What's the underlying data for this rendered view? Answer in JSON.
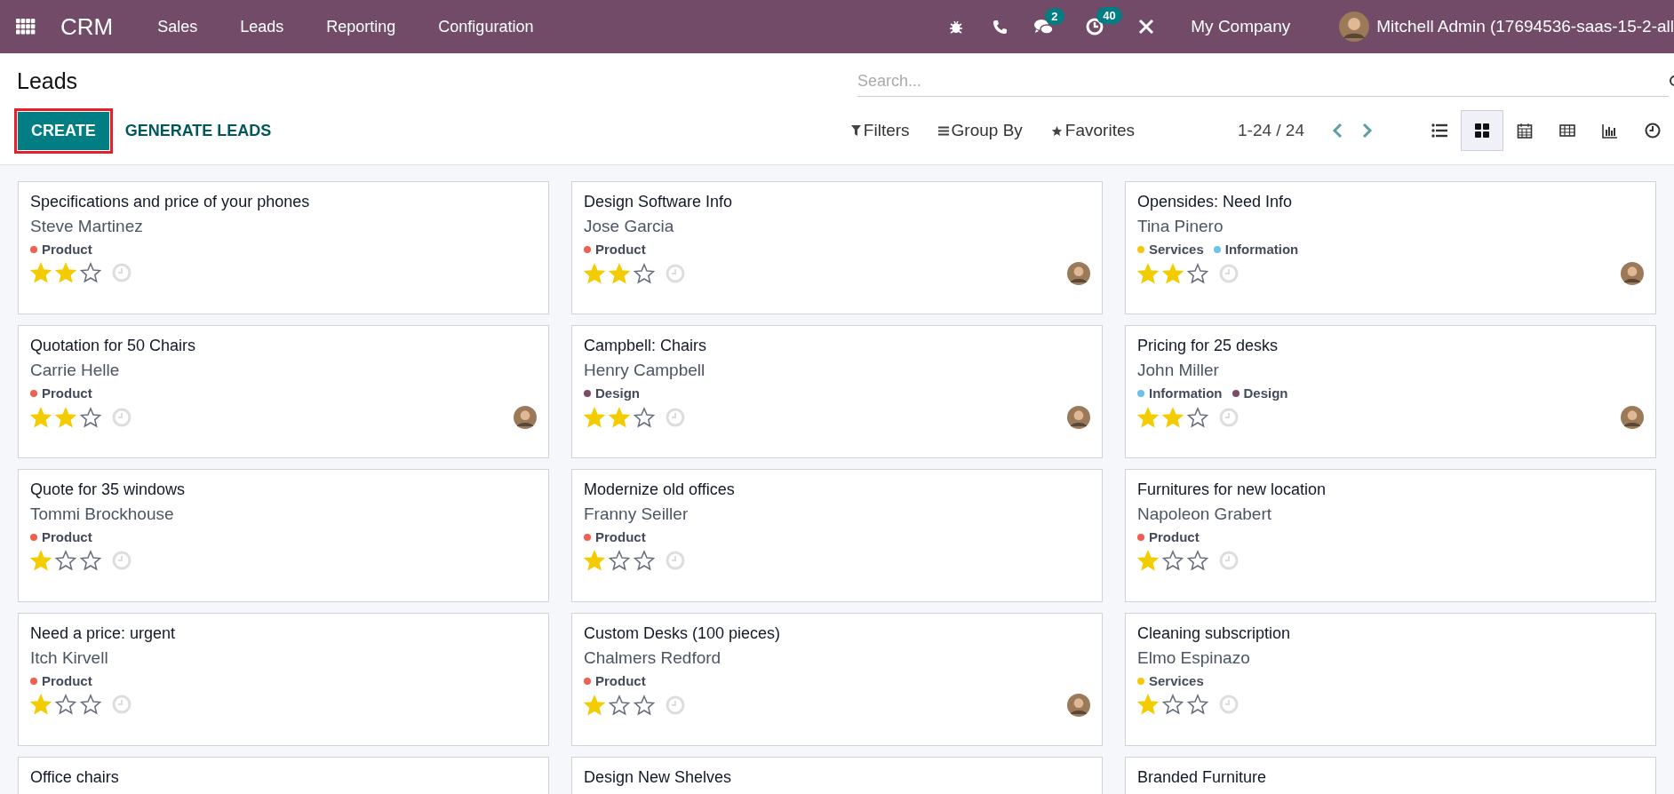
{
  "navbar": {
    "app_name": "CRM",
    "menu": [
      "Sales",
      "Leads",
      "Reporting",
      "Configuration"
    ],
    "messages_badge": "2",
    "activities_badge": "40",
    "company": "My Company",
    "user": "Mitchell Admin (17694536-saas-15-2-all"
  },
  "control_panel": {
    "title": "Leads",
    "create_button": "CREATE",
    "generate_button": "GENERATE LEADS",
    "search": {
      "placeholder": "Search..."
    },
    "filters": "Filters",
    "group_by": "Group By",
    "favorites": "Favorites",
    "pager": "1-24 / 24",
    "views": [
      {
        "kind": "list",
        "selected": false
      },
      {
        "kind": "kanban",
        "selected": true
      },
      {
        "kind": "calendar",
        "selected": false
      },
      {
        "kind": "pivot",
        "selected": false
      },
      {
        "kind": "graph",
        "selected": false
      },
      {
        "kind": "activity",
        "selected": false
      }
    ]
  },
  "cards": [
    {
      "title": "Specifications and price of your phones",
      "customer": "Steve Martinez",
      "tags": [
        {
          "label": "Product",
          "color": "#f06050"
        }
      ],
      "stars": 2,
      "avatar": false
    },
    {
      "title": "Design Software Info",
      "customer": "Jose Garcia",
      "tags": [
        {
          "label": "Product",
          "color": "#f06050"
        }
      ],
      "stars": 2,
      "avatar": true
    },
    {
      "title": "Opensides: Need Info",
      "customer": "Tina Pinero",
      "tags": [
        {
          "label": "Services",
          "color": "#f4c609"
        },
        {
          "label": "Information",
          "color": "#6cc1ed"
        }
      ],
      "stars": 2,
      "avatar": true
    },
    {
      "title": "Quotation for 50 Chairs",
      "customer": "Carrie Helle",
      "tags": [
        {
          "label": "Product",
          "color": "#f06050"
        }
      ],
      "stars": 2,
      "avatar": true
    },
    {
      "title": "Campbell: Chairs",
      "customer": "Henry Campbell",
      "tags": [
        {
          "label": "Design",
          "color": "#814968"
        }
      ],
      "stars": 2,
      "avatar": true
    },
    {
      "title": "Pricing for 25 desks",
      "customer": "John Miller",
      "tags": [
        {
          "label": "Information",
          "color": "#6cc1ed"
        },
        {
          "label": "Design",
          "color": "#814968"
        }
      ],
      "stars": 2,
      "avatar": true
    },
    {
      "title": "Quote for 35 windows",
      "customer": "Tommi Brockhouse",
      "tags": [
        {
          "label": "Product",
          "color": "#f06050"
        }
      ],
      "stars": 1,
      "avatar": false
    },
    {
      "title": "Modernize old offices",
      "customer": "Franny Seiller",
      "tags": [
        {
          "label": "Product",
          "color": "#f06050"
        }
      ],
      "stars": 1,
      "avatar": false
    },
    {
      "title": "Furnitures for new location",
      "customer": "Napoleon Grabert",
      "tags": [
        {
          "label": "Product",
          "color": "#f06050"
        }
      ],
      "stars": 1,
      "avatar": false
    },
    {
      "title": "Need a price: urgent",
      "customer": "Itch Kirvell",
      "tags": [
        {
          "label": "Product",
          "color": "#f06050"
        }
      ],
      "stars": 1,
      "avatar": false
    },
    {
      "title": "Custom Desks (100 pieces)",
      "customer": "Chalmers Redford",
      "tags": [
        {
          "label": "Product",
          "color": "#f06050"
        }
      ],
      "stars": 1,
      "avatar": true
    },
    {
      "title": "Cleaning subscription",
      "customer": "Elmo Espinazo",
      "tags": [
        {
          "label": "Services",
          "color": "#f4c609"
        }
      ],
      "stars": 1,
      "avatar": false
    },
    {
      "title": "Office chairs"
    },
    {
      "title": "Design New Shelves"
    },
    {
      "title": "Branded Furniture"
    }
  ]
}
